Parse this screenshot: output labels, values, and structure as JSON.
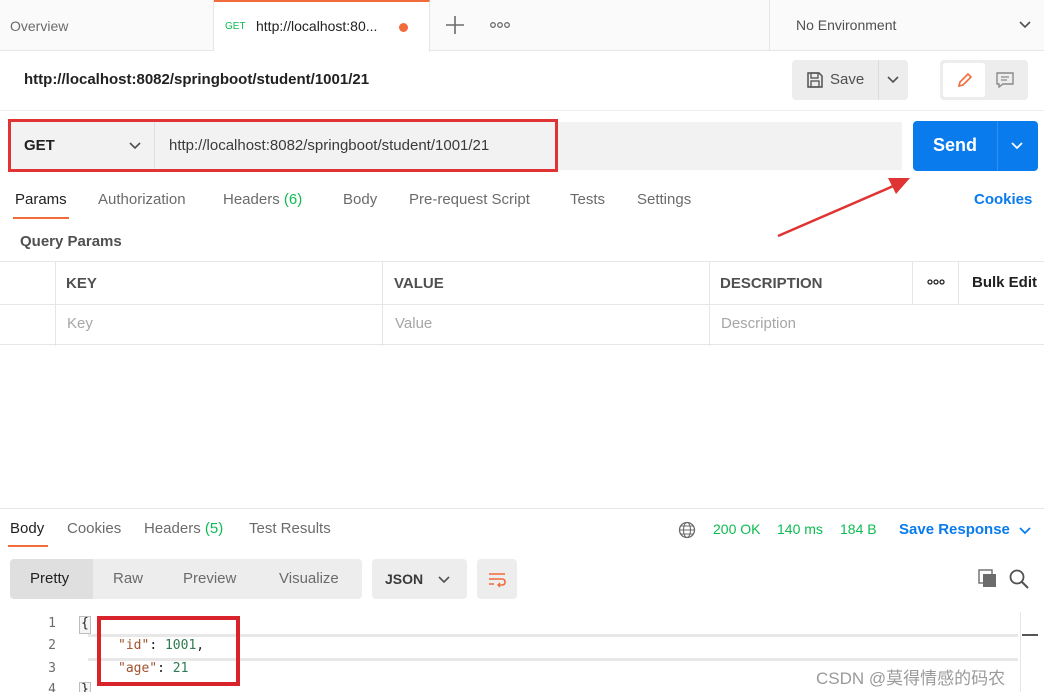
{
  "tabs": {
    "overview_label": "Overview",
    "active_method": "GET",
    "active_url": "http://localhost:80...",
    "environment": "No Environment"
  },
  "request": {
    "title": "http://localhost:8082/springboot/student/1001/21",
    "save_label": "Save",
    "method": "GET",
    "url": "http://localhost:8082/springboot/student/1001/21",
    "send_label": "Send"
  },
  "request_tabs": {
    "items": [
      "Params",
      "Authorization",
      "Headers",
      "Body",
      "Pre-request Script",
      "Tests",
      "Settings"
    ],
    "headers_count": "(6)",
    "cookies_label": "Cookies"
  },
  "query_params": {
    "title": "Query Params",
    "columns": [
      "KEY",
      "VALUE",
      "DESCRIPTION"
    ],
    "placeholders": [
      "Key",
      "Value",
      "Description"
    ],
    "bulk_edit_label": "Bulk Edit"
  },
  "response": {
    "tabs": [
      "Body",
      "Cookies",
      "Headers",
      "Test Results"
    ],
    "headers_count": "(5)",
    "status": "200 OK",
    "time": "140 ms",
    "size": "184 B",
    "save_response_label": "Save Response",
    "views": [
      "Pretty",
      "Raw",
      "Preview",
      "Visualize"
    ],
    "format": "JSON",
    "line_numbers": [
      "1",
      "2",
      "3",
      "4"
    ],
    "body": {
      "open": "{",
      "id_key": "\"id\"",
      "id_value": "1001",
      "age_key": "\"age\"",
      "age_value": "21",
      "close": "}"
    }
  },
  "watermark": "CSDN @莫得情感的码农",
  "colors": {
    "accent": "#f26b3a",
    "primary": "#097bed",
    "success": "#0cbb52",
    "annotation": "#e03434"
  }
}
